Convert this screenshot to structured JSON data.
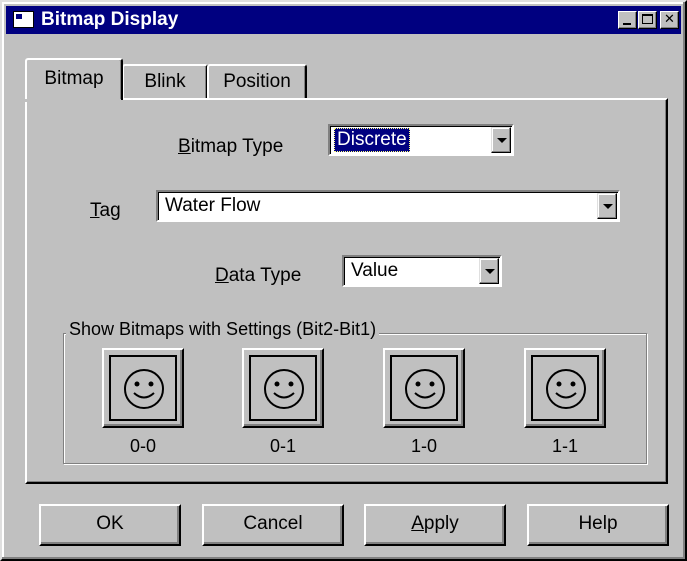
{
  "window": {
    "title": "Bitmap Display",
    "icon": "bitmap-app-icon"
  },
  "tabs": [
    {
      "label": "Bitmap",
      "active": true
    },
    {
      "label": "Blink",
      "active": false
    },
    {
      "label": "Position",
      "active": false
    }
  ],
  "form": {
    "bitmap_type": {
      "label_pre": "",
      "label_mnemonic": "B",
      "label_post": "itmap Type",
      "value": "Discrete"
    },
    "tag": {
      "label_mnemonic": "T",
      "label_post": "ag",
      "value": "Water Flow"
    },
    "data_type": {
      "label_mnemonic": "D",
      "label_post": "ata Type",
      "value": "Value"
    }
  },
  "group": {
    "label": "Show Bitmaps with Settings (Bit2-Bit1)",
    "bitmaps": [
      {
        "caption": "0-0",
        "icon": "smiley-face-icon"
      },
      {
        "caption": "0-1",
        "icon": "smiley-face-icon"
      },
      {
        "caption": "1-0",
        "icon": "smiley-face-icon"
      },
      {
        "caption": "1-1",
        "icon": "smiley-face-icon"
      }
    ]
  },
  "buttons": {
    "ok": "OK",
    "cancel": "Cancel",
    "apply_mnemonic": "A",
    "apply_rest": "pply",
    "help": "Help"
  },
  "colors": {
    "titlebar": "#000080",
    "face": "#c0c0c0",
    "selection": "#000080"
  }
}
